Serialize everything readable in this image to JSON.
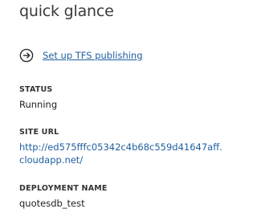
{
  "quick_glance": {
    "title": "quick glance",
    "action": {
      "icon": "arrow-circle-right-icon",
      "label": "Set up TFS publishing"
    },
    "status": {
      "label": "STATUS",
      "value": "Running"
    },
    "site_url": {
      "label": "SITE URL",
      "line1": "http://ed575fffc05342c4b68c559d41647aff.",
      "line2": "cloudapp.net/"
    },
    "deployment_name": {
      "label": "DEPLOYMENT NAME",
      "value": "quotesdb_test"
    }
  },
  "colors": {
    "link": "#1f5f9f",
    "text": "#1f1f1f",
    "title": "#3a3a3a"
  }
}
